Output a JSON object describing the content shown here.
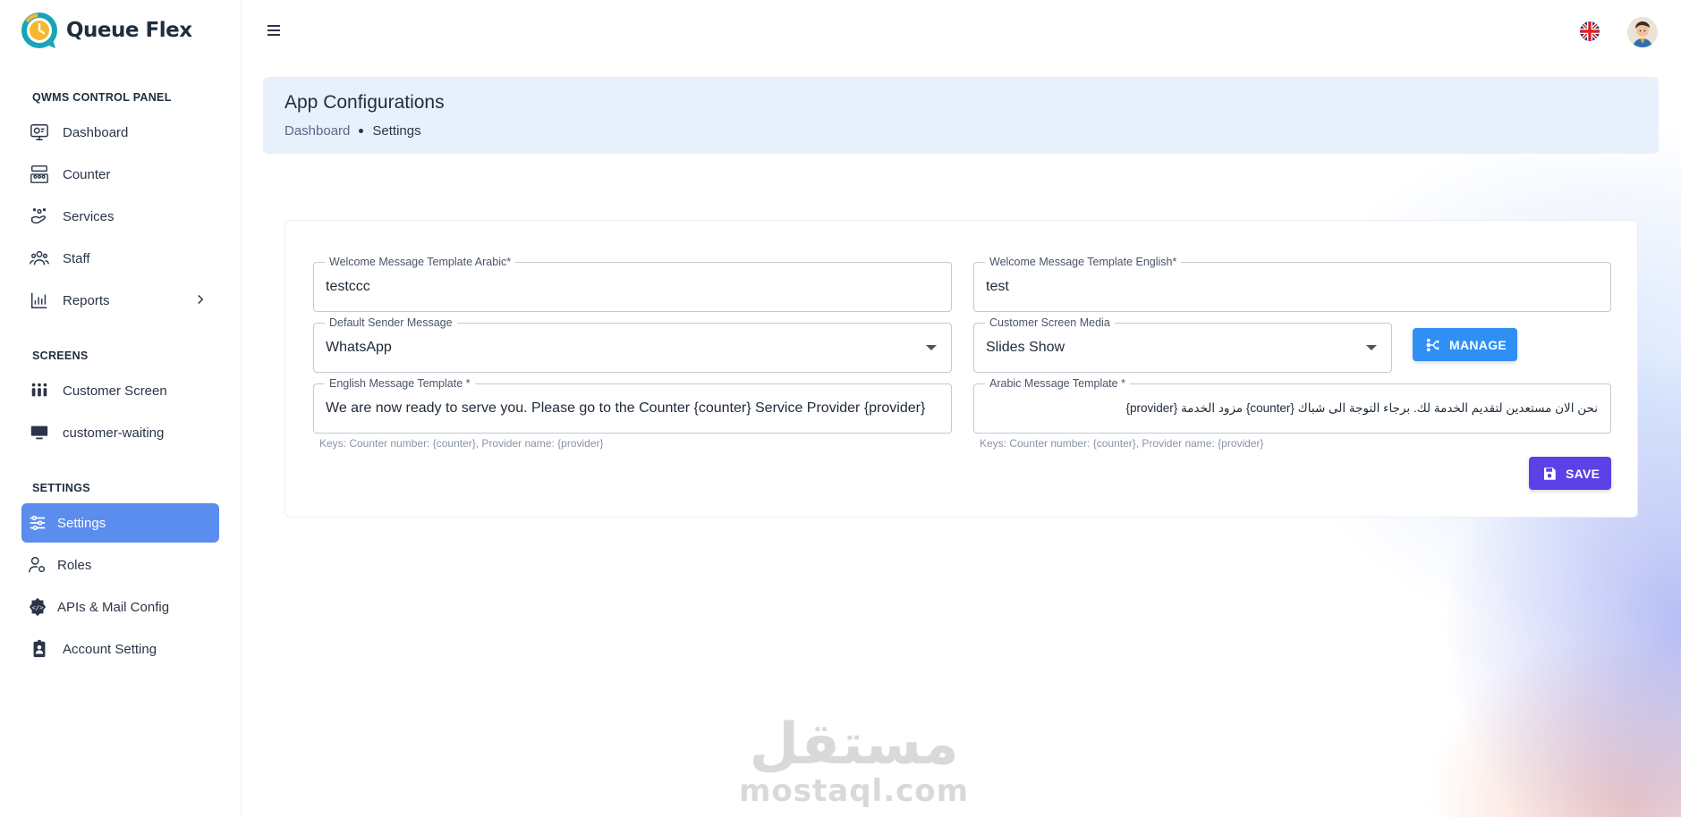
{
  "app": {
    "name": "Queue Flex"
  },
  "sidebar": {
    "sections": [
      {
        "title": "QWMS CONTROL PANEL"
      },
      {
        "title": "SCREENS"
      },
      {
        "title": "SETTINGS"
      }
    ],
    "items": [
      {
        "label": "Dashboard",
        "icon": "dashboard-icon"
      },
      {
        "label": "Counter",
        "icon": "counter-icon"
      },
      {
        "label": "Services",
        "icon": "services-icon"
      },
      {
        "label": "Staff",
        "icon": "staff-icon"
      },
      {
        "label": "Reports",
        "icon": "reports-icon"
      },
      {
        "label": "Customer Screen",
        "icon": "customer-screen-icon"
      },
      {
        "label": "customer-waiting",
        "icon": "monitor-icon"
      },
      {
        "label": "Settings",
        "icon": "sliders-icon",
        "active": true
      },
      {
        "label": "Roles",
        "icon": "roles-icon"
      },
      {
        "label": "APIs & Mail Config",
        "icon": "api-gear-icon"
      },
      {
        "label": "Account Setting",
        "icon": "account-badge-icon"
      }
    ]
  },
  "header": {
    "title": "App Configurations",
    "breadcrumb": {
      "link": "Dashboard",
      "current": "Settings"
    }
  },
  "form": {
    "welcome_ar": {
      "label": "Welcome Message Template Arabic*",
      "value": "testccc"
    },
    "welcome_en": {
      "label": "Welcome Message Template English*",
      "value": "test"
    },
    "sender": {
      "label": "Default Sender Message",
      "value": "WhatsApp"
    },
    "media": {
      "label": "Customer Screen Media",
      "value": "Slides Show"
    },
    "english_template": {
      "label": "English Message Template *",
      "value": "We are now ready to serve you. Please go to the Counter {counter} Service Provider {provider}",
      "hint": "Keys: Counter number: {counter}, Provider name: {provider}"
    },
    "arabic_template": {
      "label": "Arabic Message Template *",
      "value": "نحن الان مستعدين لتقديم الخدمة لك. برجاء التوجة الى شباك {counter} مزود الخدمة {provider}",
      "hint": "Keys: Counter number: {counter}, Provider name: {provider}"
    },
    "manage_label": "MANAGE",
    "save_label": "SAVE"
  },
  "watermark": {
    "arabic": "مستقل",
    "latin": "mostaql.com"
  },
  "colors": {
    "accent": "#5b8def",
    "manage": "#2f8ff5",
    "save": "#5b42e6",
    "header_band": "#e8f0fc"
  }
}
